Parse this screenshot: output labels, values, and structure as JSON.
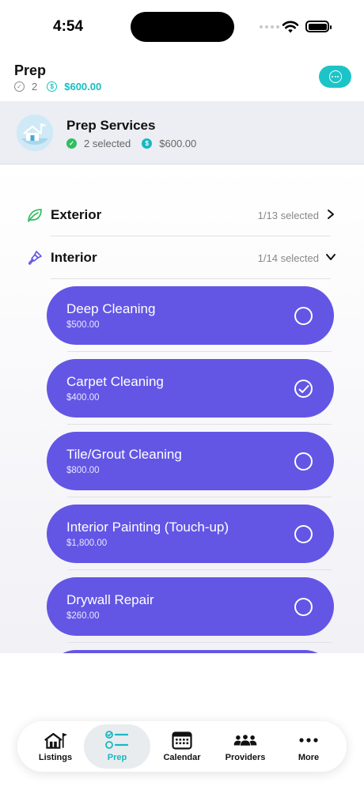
{
  "status_bar": {
    "time": "4:54"
  },
  "header": {
    "title": "Prep",
    "selected_count": "2",
    "total_price": "$600.00",
    "more_icon": "ellipsis-circle-icon"
  },
  "service": {
    "title": "Prep Services",
    "selected_text": "2 selected",
    "total_price": "$600.00",
    "icon": "house-flag-icon"
  },
  "categories": [
    {
      "label": "Exterior",
      "count_text": "1/13 selected",
      "icon": "leaf-icon",
      "expanded": false
    },
    {
      "label": "Interior",
      "count_text": "1/14 selected",
      "icon": "paintbrush-icon",
      "expanded": true
    }
  ],
  "items": [
    {
      "name": "Deep Cleaning",
      "price": "$500.00",
      "selected": false
    },
    {
      "name": "Carpet Cleaning",
      "price": "$400.00",
      "selected": true
    },
    {
      "name": "Tile/Grout Cleaning",
      "price": "$800.00",
      "selected": false
    },
    {
      "name": "Interior Painting (Touch-up)",
      "price": "$1,800.00",
      "selected": false
    },
    {
      "name": "Drywall Repair",
      "price": "$260.00",
      "selected": false
    }
  ],
  "tabs": [
    {
      "label": "Listings",
      "icon": "house-flag-icon",
      "active": false
    },
    {
      "label": "Prep",
      "icon": "checklist-icon",
      "active": true
    },
    {
      "label": "Calendar",
      "icon": "calendar-icon",
      "active": false
    },
    {
      "label": "Providers",
      "icon": "people-icon",
      "active": false
    },
    {
      "label": "More",
      "icon": "more-dots-icon",
      "active": false
    }
  ],
  "colors": {
    "accent_teal": "#1cc4c8",
    "item_purple": "#6356e5",
    "selected_green": "#2fbe5f"
  }
}
